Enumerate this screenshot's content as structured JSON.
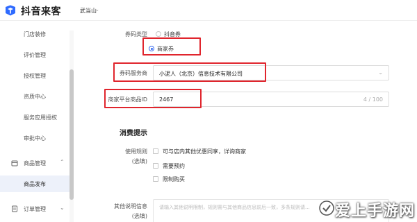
{
  "header": {
    "app_name": "抖音来客",
    "account": "武当山",
    "account_chevron": "⌄"
  },
  "sidebar": {
    "items": [
      {
        "label": "门店装修"
      },
      {
        "label": "评价管理"
      },
      {
        "label": "授权管理"
      },
      {
        "label": "资质中心"
      },
      {
        "label": "服务应用授权"
      },
      {
        "label": "审批中心"
      }
    ],
    "product_group": {
      "label": "商品管理",
      "icon": "box-icon",
      "chevron": "⌃"
    },
    "active_item": {
      "label": "商品发布"
    },
    "order_group": {
      "label": "订单管理",
      "icon": "order-icon",
      "chevron": "⌄"
    }
  },
  "form": {
    "coupon_type": {
      "label": "券码类型",
      "options": [
        {
          "label": "抖音券",
          "checked": false
        },
        {
          "label": "商家券",
          "checked": true
        }
      ]
    },
    "coupon_provider": {
      "label": "券码服务商",
      "value": "小泥人（北京）信息技术有限公司",
      "chevron": "⌄"
    },
    "merchant_product_id": {
      "label": "商家平台商品ID",
      "value": "2467",
      "counter": "4 / 100"
    },
    "consumption_section_title": "消费提示",
    "usage_rules": {
      "label": "使用规则",
      "sublabel": "(选填)",
      "options": [
        {
          "label": "可与店内其他优惠同享，详询商家"
        },
        {
          "label": "需要预约"
        },
        {
          "label": "限制购买"
        }
      ]
    },
    "other_notes": {
      "label": "其他说明信息",
      "sublabel": "(选填)",
      "placeholder": "请输入其他说明限制，规则需与其他商品信息前后一致，多条规则请..."
    }
  },
  "watermark": {
    "text": "爱上手游网"
  },
  "colors": {
    "accent": "#3a6df0",
    "highlight": "#e0252d",
    "active_bg": "#edf1fa"
  }
}
